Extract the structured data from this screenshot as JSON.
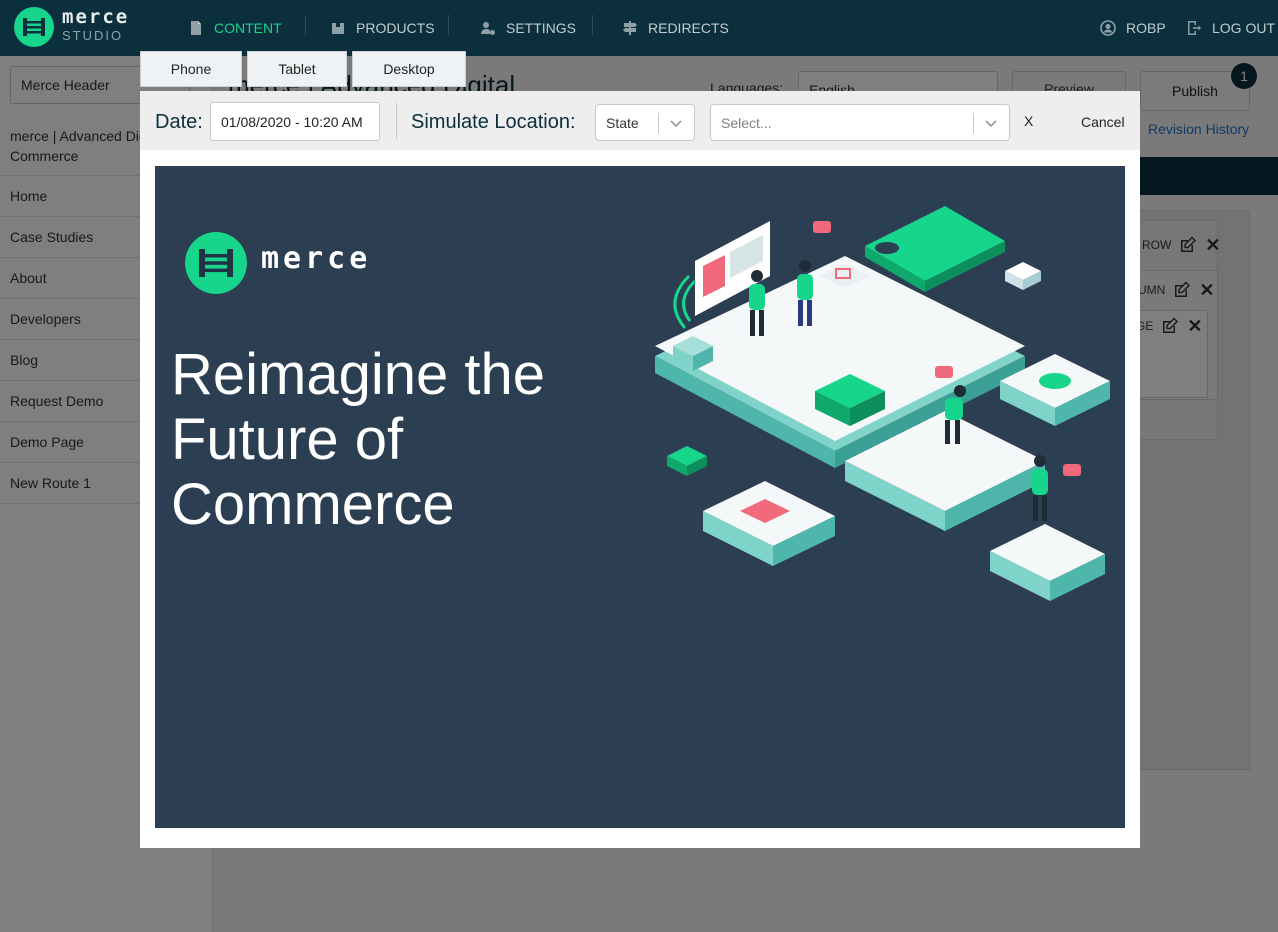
{
  "nav": {
    "brand": "merce",
    "brand_sub": "STUDIO",
    "items": [
      {
        "label": "CONTENT",
        "icon": "file-icon",
        "active": true
      },
      {
        "label": "PRODUCTS",
        "icon": "box-icon",
        "active": false
      },
      {
        "label": "SETTINGS",
        "icon": "user-gear-icon",
        "active": false
      },
      {
        "label": "REDIRECTS",
        "icon": "signpost-icon",
        "active": false
      }
    ],
    "user": "ROBP",
    "logout": "LOG OUT",
    "active_color": "#17d68c"
  },
  "sidebar": {
    "page_select": "Merce Header",
    "items": [
      "merce | Advanced Digital Commerce",
      "Home",
      "Case Studies",
      "About",
      "Developers",
      "Blog",
      "Request Demo",
      "Demo Page",
      "New Route 1"
    ]
  },
  "editor": {
    "heading": "merce | Advanced Digital",
    "languages_label": "Languages:",
    "language_value": "English",
    "preview_label": "Preview",
    "publish_label": "Publish",
    "publish_badge": "1",
    "revision_history": "Revision History",
    "tree": {
      "row": "ROW",
      "column": "UMN",
      "image": "GE"
    }
  },
  "device_tabs": [
    "Phone",
    "Tablet",
    "Desktop"
  ],
  "preview": {
    "date_label": "Date:",
    "date_value": "01/08/2020 - 10:20 AM",
    "location_label": "Simulate Location:",
    "state_value": "State",
    "region_placeholder": "Select...",
    "clear_label": "X",
    "cancel_label": "Cancel"
  },
  "hero": {
    "brand": "merce",
    "title": "Reimagine the Future of Commerce",
    "bg_color": "#2c3e52",
    "accent": "#17d68c"
  }
}
